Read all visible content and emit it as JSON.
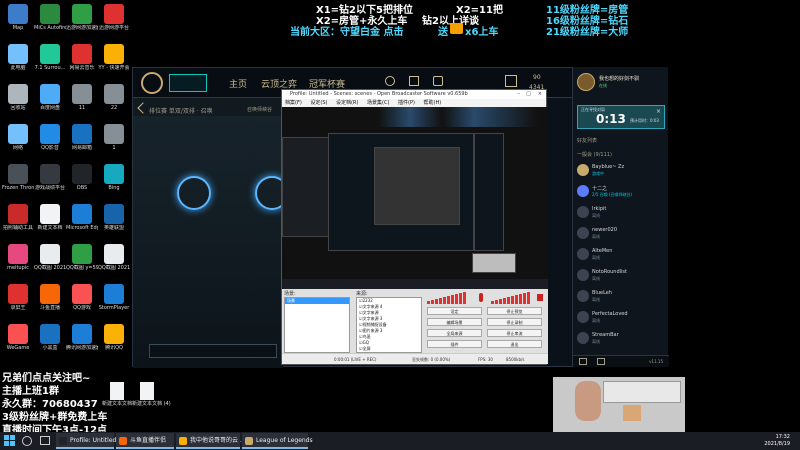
{
  "desktop": {
    "icons": [
      {
        "label": "Map",
        "color": "#3d7cc9"
      },
      {
        "label": "MiCs Autofire",
        "color": "#2b8a3e"
      },
      {
        "label": "迅游网游加速器",
        "color": "#2f9e44"
      },
      {
        "label": "迅游网游平台",
        "color": "#e03131"
      },
      {
        "label": "此电脑",
        "color": "#74c0fc"
      },
      {
        "label": "7.1 Surrou...",
        "color": "#20c997"
      },
      {
        "label": "网易云音乐",
        "color": "#e03131"
      },
      {
        "label": "YY - 快速开会",
        "color": "#fab005"
      },
      {
        "label": "回收站",
        "color": "#adb5bd"
      },
      {
        "label": "百度网盘",
        "color": "#4dabf7"
      },
      {
        "label": "11",
        "color": "#868e96"
      },
      {
        "label": "22",
        "color": "#868e96"
      },
      {
        "label": "网络",
        "color": "#74c0fc"
      },
      {
        "label": "QQ影音",
        "color": "#228be6"
      },
      {
        "label": "网易邮箱",
        "color": "#1971c2"
      },
      {
        "label": "1",
        "color": "#868e96"
      },
      {
        "label": "Frozen Throne",
        "color": "#495057"
      },
      {
        "label": "游戏战绩平台",
        "color": "#343a40"
      },
      {
        "label": "OBS",
        "color": "#212529"
      },
      {
        "label": "Bing",
        "color": "#15aabf"
      },
      {
        "label": "拍照辅助工具",
        "color": "#c92a2a"
      },
      {
        "label": "新建文本档",
        "color": "#f1f3f5"
      },
      {
        "label": "Microsoft Edge",
        "color": "#1c7ed6"
      },
      {
        "label": "英雄联盟",
        "color": "#1864ab"
      },
      {
        "label": "meitupic",
        "color": "#e64980"
      },
      {
        "label": "QQ截图 20210731...",
        "color": "#e9ecef"
      },
      {
        "label": "QQ截图 y=5916...",
        "color": "#2f9e44"
      },
      {
        "label": "QQ截图 2021073...",
        "color": "#e9ecef"
      },
      {
        "label": "录屏王",
        "color": "#e03131"
      },
      {
        "label": "斗鱼直播",
        "color": "#f76707"
      },
      {
        "label": "QQ游戏",
        "color": "#fa5252"
      },
      {
        "label": "StormPlayer",
        "color": "#1c7ed6"
      },
      {
        "label": "WeGame",
        "color": "#fa5252"
      },
      {
        "label": "小黑盒",
        "color": "#1971c2"
      },
      {
        "label": "腾讯网游加速器",
        "color": "#1c7ed6"
      },
      {
        "label": "腾讯QQ",
        "color": "#fab005"
      }
    ],
    "extra_files": [
      "新建文本文档",
      "新建文本文档 (4)"
    ]
  },
  "overlay_top": {
    "l1_left": "X1=钻2以下5把排位",
    "l1_mid": "X2=11把",
    "l1_right": "11级粉丝牌=房管",
    "l2_left": "X2=房管+永久上车",
    "l2_mid": "钻2以上详谈",
    "l2_right": "16级粉丝牌=钻石",
    "l3_left": "当前大区：守望白金  点击",
    "l3_mid": "送",
    "l3_x6": "x6上车",
    "l3_right": "21级粉丝牌=大师"
  },
  "lol": {
    "nav_home": "主页",
    "nav_tft": "云顶之弈",
    "nav_rank": "冠军杯赛",
    "subtitle": "排位赛 单双/双排 · 召唤",
    "subtitle2": "召唤师峡谷",
    "currency_be": "90",
    "currency_rp": "4341",
    "profile_name": "我也想的好剑不驯",
    "profile_status": "在线",
    "queue_label": "正在寻找对局",
    "queue_time": "0:13",
    "queue_est": "预计用时：0:03",
    "social_tab": "好友列表",
    "group_label": "一般会 (9/111)",
    "friends": [
      {
        "name": "Bayblue~ Zz",
        "status": "游戏中"
      },
      {
        "name": "十二之",
        "status": "2/5 召唤 (召唤师峡谷)"
      },
      {
        "name": "Irkipit",
        "status": "离线"
      },
      {
        "name": "newer020",
        "status": "离线"
      },
      {
        "name": "AlteMen",
        "status": "离线"
      },
      {
        "name": "NotoRoundlist",
        "status": "离线"
      },
      {
        "name": "BlueLeh",
        "status": "离线"
      },
      {
        "name": "PerfectaLoved",
        "status": "离线"
      },
      {
        "name": "StreamBar",
        "status": "离线"
      }
    ],
    "footer_version": "v11.15"
  },
  "obs": {
    "title": "Profile: Untitled - Scenes: scenes - Open Broadcaster Software v0.659b",
    "menu": [
      "档案(F)",
      "设定(S)",
      "设定档(R)",
      "场景集(C)",
      "插件(P)",
      "帮助(H)"
    ],
    "scenes_label": "场景:",
    "scene_selected": "场景",
    "sources_label": "来源:",
    "sources": [
      "2232",
      "文字来源 4",
      "文字来源",
      "文字来源 3",
      "视频捕捉设备",
      "图片来源 3",
      "鸟笼",
      "GQ",
      "全屏"
    ],
    "buttons": {
      "settings": "设定",
      "stop_preview": "停止预览",
      "edit_scene": "编辑场景",
      "stop_record": "停止录制",
      "global_sources": "全局来源",
      "stop_stream": "停止串流",
      "plugins": "插件",
      "exit": "退出"
    },
    "status": {
      "time": "0:00:01 (LIVE + REC)",
      "dropped": "丢失帧数: 0 (0.00%)",
      "fps": "FPS: 30",
      "bitrate": "8500kb/s"
    }
  },
  "overlay_bl": {
    "line1": "兄弟们点点关注吧~",
    "line2": "主播上班1群",
    "line3": "永久群：70680437",
    "line4": "3级粉丝牌+群免费上车",
    "line5": "直播时间下午3点-12点"
  },
  "taskbar": {
    "tasks": [
      {
        "label": "Profile: Untitled - S...",
        "color": "#212529"
      },
      {
        "label": "斗鱼直播伴侣",
        "color": "#f76707"
      },
      {
        "label": "我中他说哥哥的云 ...",
        "color": "#fab005"
      },
      {
        "label": "League of Legends",
        "color": "#c8aa6e"
      }
    ],
    "time": "17:32",
    "date": "2021/8/19"
  }
}
